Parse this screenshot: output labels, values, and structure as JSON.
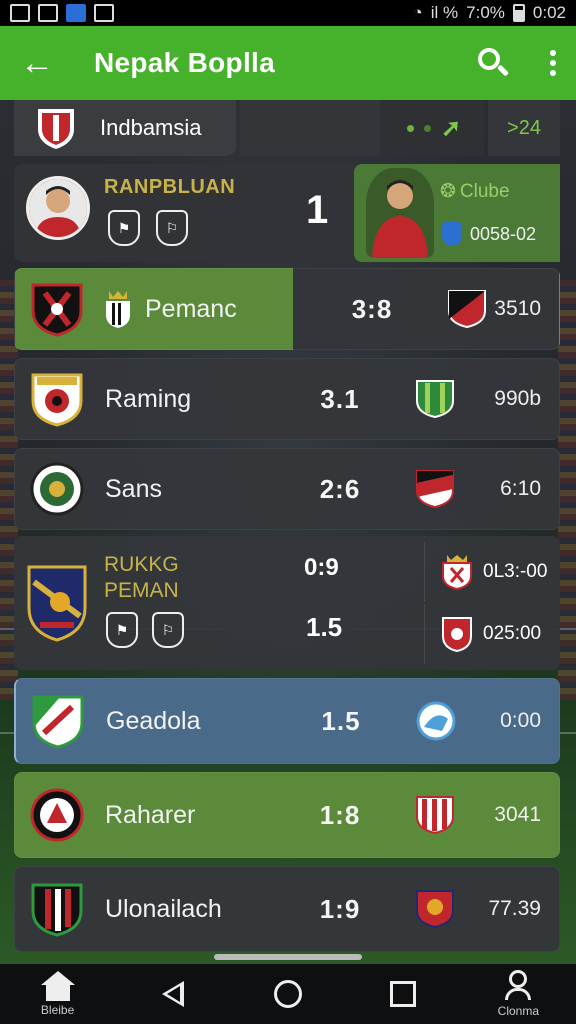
{
  "status_bar": {
    "time": "7:0%",
    "clock": "0:02",
    "signal_text": "il %"
  },
  "app_bar": {
    "title": "Nepak Boplla",
    "back_icon": "arrow-left-icon",
    "search_icon": "search-icon",
    "more_icon": "more-vert-icon"
  },
  "header_row": {
    "country": "Indbamsia",
    "right_label": "24"
  },
  "featured": {
    "label": "RANPBLUAN",
    "score": "1",
    "clubs_label": "Clube",
    "time": "0058-02"
  },
  "matches": [
    {
      "name": "Pemanc",
      "score": "3:8",
      "time": "3510",
      "home_color": "#c0272d",
      "away_color": "#c0272d"
    },
    {
      "name": "Raming",
      "score": "3.1",
      "time": "990b",
      "home_color": "#d8b13a",
      "away_color": "#2e8a3a"
    },
    {
      "name": "Sans",
      "score": "2:6",
      "time": "6:10",
      "home_color": "#2b6a36",
      "away_color": "#c0272d"
    }
  ],
  "double_match": {
    "label_line1": "RUKKG",
    "label_line2": "PEMAN",
    "score_top": "0:9",
    "score_bottom": "1.5",
    "time_top": "0L3:-00",
    "time_bottom": "025:00"
  },
  "matches2": [
    {
      "name": "Geadola",
      "score": "1.5",
      "time": "0:00",
      "home_color": "#2e9a3e",
      "away_color": "#4fa0d8"
    },
    {
      "name": "Raharer",
      "score": "1:8",
      "time": "3041",
      "home_color": "#c0272d",
      "away_color": "#c0272d"
    },
    {
      "name": "Ulonailach",
      "score": "1:9",
      "time": "77.39",
      "home_color": "#c0272d",
      "away_color": "#e3a828"
    }
  ],
  "nav": {
    "home_label": "Bleibe",
    "profile_label": "Clonma"
  }
}
